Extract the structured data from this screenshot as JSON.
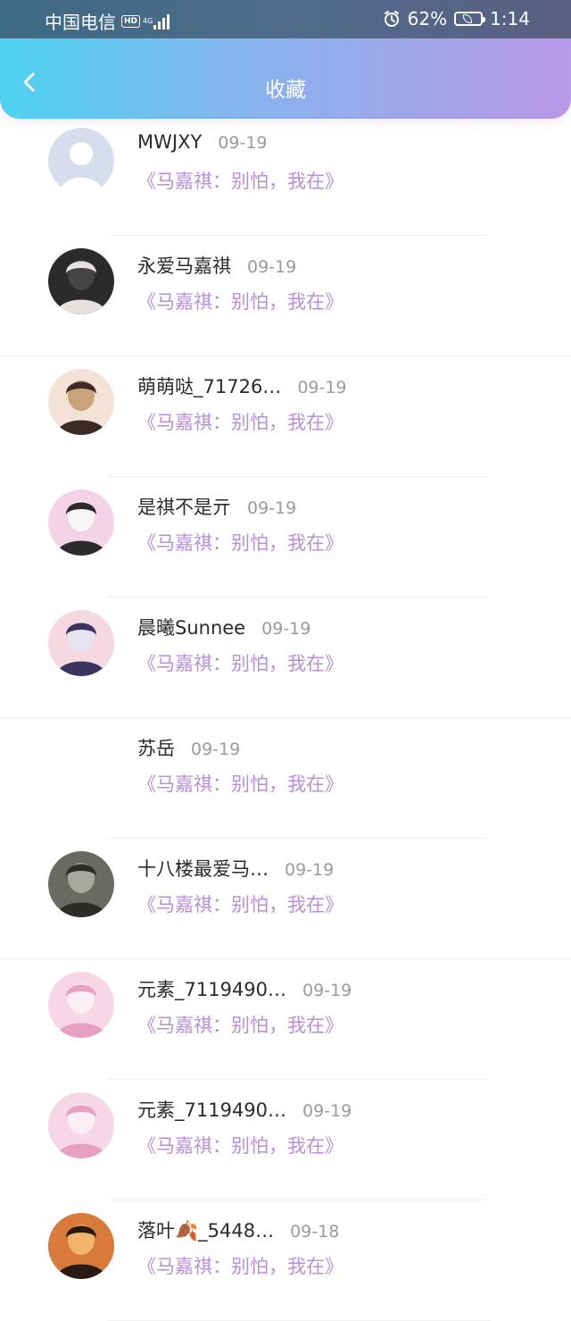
{
  "status": {
    "carrier": "中国电信",
    "hd": "HD",
    "net": "4G",
    "battery": "62%",
    "time": "1:14"
  },
  "header": {
    "title": "收藏"
  },
  "items": [
    {
      "name": "MWJXY",
      "date": "09-19",
      "work": "《马嘉祺：别怕，我在》",
      "avatar": "avatar-default"
    },
    {
      "name": "永爱马嘉祺",
      "date": "09-19",
      "work": "《马嘉祺：别怕，我在》",
      "avatar": "avatar-photo"
    },
    {
      "name": "萌萌哒_71726…",
      "date": "09-19",
      "work": "《马嘉祺：别怕，我在》",
      "avatar": "avatar-illustration"
    },
    {
      "name": "是祺不是亓",
      "date": "09-19",
      "work": "《马嘉祺：别怕，我在》",
      "avatar": "avatar-photo"
    },
    {
      "name": "晨曦Sunnee",
      "date": "09-19",
      "work": "《马嘉祺：别怕，我在》",
      "avatar": "avatar-illustration"
    },
    {
      "name": "苏岳",
      "date": "09-19",
      "work": "《马嘉祺：别怕，我在》",
      "avatar": "none"
    },
    {
      "name": "十八楼最爱马…",
      "date": "09-19",
      "work": "《马嘉祺：别怕，我在》",
      "avatar": "avatar-photo"
    },
    {
      "name": "元素_7119490…",
      "date": "09-19",
      "work": "《马嘉祺：别怕，我在》",
      "avatar": "avatar-anime"
    },
    {
      "name": "元素_7119490…",
      "date": "09-19",
      "work": "《马嘉祺：别怕，我在》",
      "avatar": "avatar-anime"
    },
    {
      "name": "落叶🍂_5448…",
      "date": "09-18",
      "work": "《马嘉祺：别怕，我在》",
      "avatar": "avatar-photo"
    }
  ],
  "colors": {
    "header_start": "#4dd2f0",
    "header_end": "#b898e8",
    "work_title": "#b88fd8",
    "date": "#9a9a9a"
  }
}
